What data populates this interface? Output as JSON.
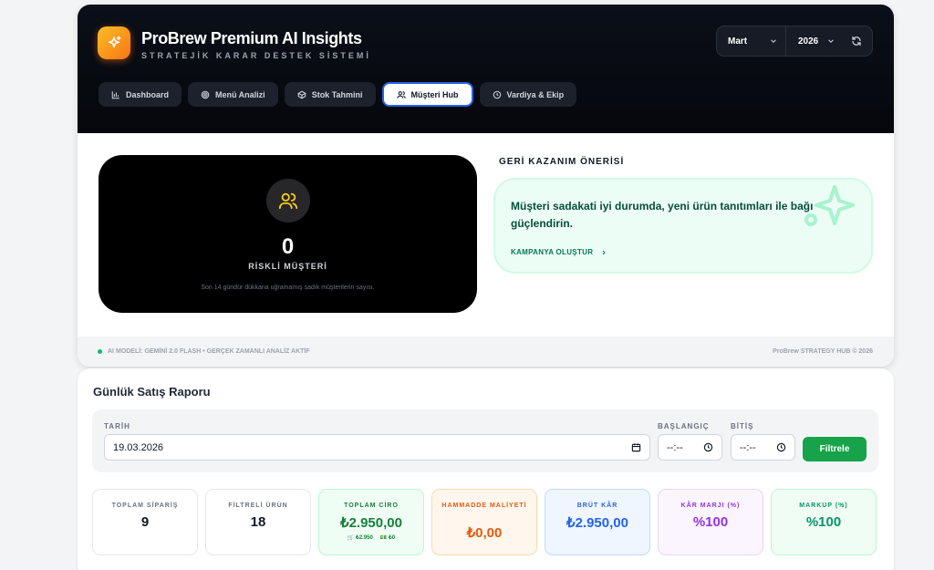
{
  "hub": {
    "title": "ProBrew Premium AI Insights",
    "subtitle": "STRATEJİK KARAR DESTEK SİSTEMİ",
    "period": {
      "month": "Mart",
      "year": "2026"
    },
    "tabs": [
      {
        "label": "Dashboard",
        "icon": "bar-chart-icon",
        "active": false
      },
      {
        "label": "Menü Analizi",
        "icon": "target-icon",
        "active": false
      },
      {
        "label": "Stok Tahmini",
        "icon": "box-icon",
        "active": false
      },
      {
        "label": "Müşteri Hub",
        "icon": "users-icon",
        "active": true
      },
      {
        "label": "Vardiya & Ekip",
        "icon": "clock-icon",
        "active": false
      }
    ],
    "risk": {
      "count": "0",
      "label": "RİSKLİ MÜŞTERİ",
      "description": "Son 14 gündür dükkana uğramamış sadık müşterilerin sayısı."
    },
    "recommendation": {
      "title": "GERİ KAZANIM ÖNERİSİ",
      "text": "Müşteri sadakati iyi durumda, yeni ürün tanıtımları ile bağı güçlendirin.",
      "link": "KAMPANYA OLUŞTUR"
    },
    "footer": {
      "model": "AI MODELİ: GEMİNİ 2.0 FLASH • GERÇEK ZAMANLI ANALİZ AKTİF",
      "brand": "ProBrew STRATEGY HUB © 2026"
    },
    "accent": "#f97316"
  },
  "report": {
    "title": "Günlük Satış Raporu",
    "filter": {
      "date_label": "TARİH",
      "date_value": "19.03.2026",
      "start_label": "BAŞLANGIÇ",
      "start_value": "--:--",
      "end_label": "BİTİŞ",
      "end_value": "--:--",
      "button": "Filtrele"
    },
    "stats": [
      {
        "label": "TOPLAM SİPARİŞ",
        "value": "9"
      },
      {
        "label": "FİLTRELİ ÜRÜN",
        "value": "18"
      },
      {
        "label": "TOPLAM CİRO",
        "value": "₺2.950,00",
        "sub_card": "₺2.950",
        "sub_cash": "₺0"
      },
      {
        "label": "HAMMADDE MALİYETİ",
        "value": "₺0,00"
      },
      {
        "label": "BRÜT KÂR",
        "value": "₺2.950,00"
      },
      {
        "label": "KÂR MARJI (%)",
        "value": "%100"
      },
      {
        "label": "MARKUP (%)",
        "value": "%100"
      }
    ],
    "button_color": "#16a34a"
  }
}
